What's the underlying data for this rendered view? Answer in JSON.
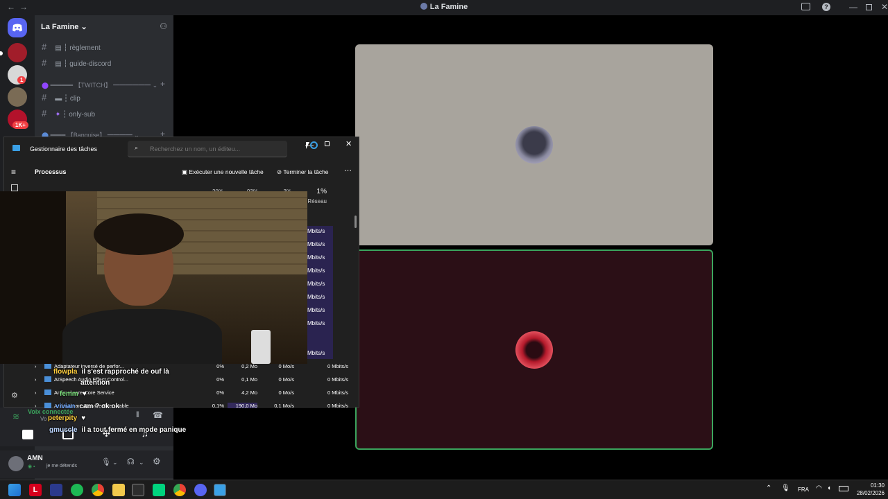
{
  "window": {
    "title": "La Famine",
    "back": "←",
    "forward": "→"
  },
  "colors": {
    "accent": "#5865f2",
    "online": "#3ba55d",
    "tm_highlight": "#332a5c"
  },
  "rail": {
    "badges": [
      "1",
      "1K+"
    ]
  },
  "sidebar": {
    "guild_name": "La Famine",
    "channels": [
      {
        "label": "┆ règlement"
      },
      {
        "label": "┆ guide-discord"
      },
      {
        "label": "━━━━━━ 【TWITCH】 ━━━━━━"
      },
      {
        "label": "┆ clip"
      },
      {
        "label": "┆ only-sub"
      },
      {
        "label": "━━━━ 【Banquise】 ━━━━"
      }
    ]
  },
  "voice": {
    "status": "Voix connectée",
    "sub": "Vo"
  },
  "user": {
    "name": "AMN",
    "status": "je me détends"
  },
  "task_manager": {
    "title": "Gestionnaire des tâches",
    "search_placeholder": "Recherchez un nom, un éditeu...",
    "section": "Processus",
    "run_task": "Exécuter une nouvelle tâche",
    "end_task": "Terminer la tâche",
    "headers": {
      "cpu": "20%",
      "mem": "93%",
      "disk": "3%",
      "net": "1%",
      "net_label": "Réseau"
    },
    "net_values": [
      "Mbits/s",
      "Mbits/s",
      "Mbits/s",
      "Mbits/s",
      "Mbits/s",
      "Mbits/s",
      "Mbits/s",
      "Mbits/s",
      "Mbits/s"
    ],
    "rows": [
      {
        "name": "Adaptateur inversé de perfor...",
        "cpu": "0%",
        "mem": "0,2 Mo",
        "disk": "0 Mo/s",
        "net": "0 Mbits/s"
      },
      {
        "name": "AISpeech Audio Effect Control...",
        "cpu": "0%",
        "mem": "0,1 Mo",
        "disk": "0 Mo/s",
        "net": "0 Mbits/s"
      },
      {
        "name": "Antimalware Core Service",
        "cpu": "0%",
        "mem": "4,2 Mo",
        "disk": "0 Mo/s",
        "net": "0 Mbits/s"
      },
      {
        "name": "Antimalware Service Executable",
        "cpu": "0,1%",
        "mem": "190,0 Mo",
        "disk": "0,1 Mo/s",
        "net": "0 Mbits/s"
      }
    ]
  },
  "chat": [
    {
      "user": "flowpla",
      "msg": "il s'est rapproché de ouf là"
    },
    {
      "user": "",
      "msg": "attention"
    },
    {
      "user": "femm",
      "msg": ""
    },
    {
      "user": "vivian",
      "msg": "cam ? ok ok"
    },
    {
      "user": "peterpity",
      "msg": ""
    },
    {
      "user": "gmuscle",
      "msg": "il a tout fermé en mode panique"
    }
  ],
  "taskbar": {
    "lang": "FRA",
    "time": "01:30",
    "date": "28/02/2026"
  }
}
